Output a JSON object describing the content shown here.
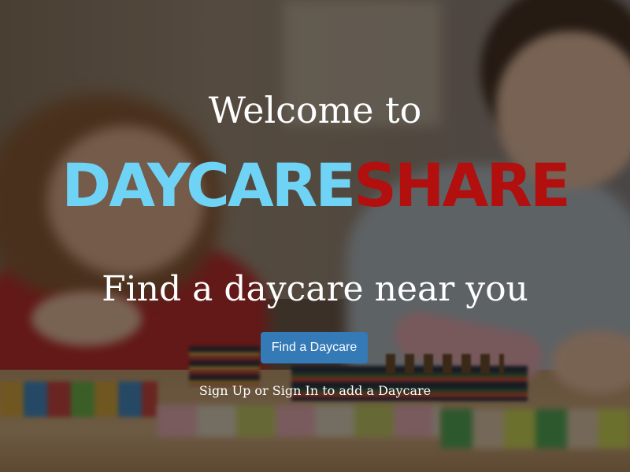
{
  "hero": {
    "welcome_text": "Welcome to",
    "brand": {
      "part_a": "DAYCARE",
      "part_b": "SHARE",
      "color_a": "#6fd3f5",
      "color_b": "#b20f0f"
    },
    "tagline": "Find a daycare near you",
    "cta_button_label": "Find a Daycare",
    "cta_button_color": "#337ab7",
    "signup_text": "Sign Up or Sign In to add a Daycare"
  }
}
